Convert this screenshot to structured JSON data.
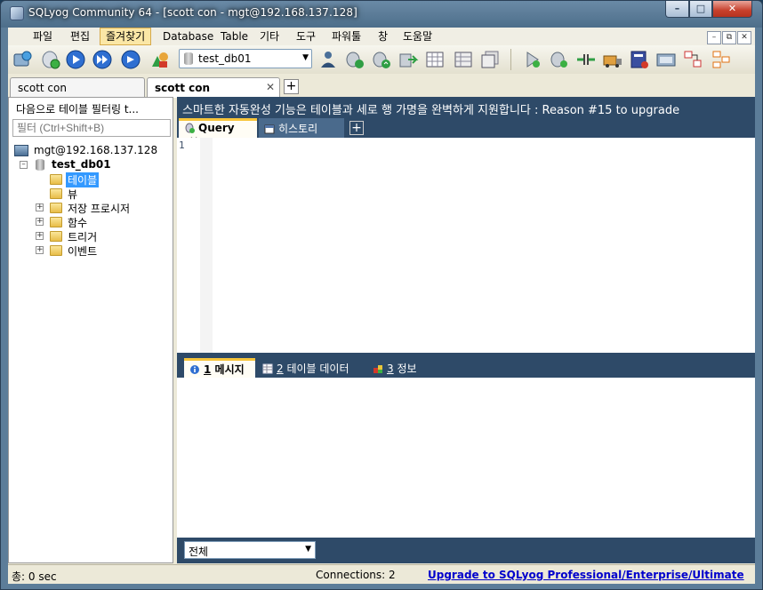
{
  "window": {
    "title": "SQLyog Community 64 - [scott con - mgt@192.168.137.128]",
    "controls": {
      "minimize": "–",
      "maximize": "□",
      "close": "✕"
    }
  },
  "menubar": {
    "items": [
      "파일",
      "편집",
      "즐겨찾기",
      "Database",
      "Table",
      "기타",
      "도구",
      "파워툴",
      "창",
      "도움말"
    ],
    "active_index": 2,
    "mdi_controls": [
      "–",
      "⧉",
      "✕"
    ]
  },
  "toolbar": {
    "database_selector": "test_db01"
  },
  "connection_tabs": [
    {
      "label": "scott con",
      "active": false
    },
    {
      "label": "scott con",
      "active": true,
      "close": "✕"
    }
  ],
  "connection_add": "+",
  "object_browser": {
    "filter_hint": "다음으로 테이블 필터링 t...",
    "filter_placeholder": "필터 (Ctrl+Shift+B)",
    "server": "mgt@192.168.137.128",
    "database": "test_db01",
    "nodes": [
      {
        "label": "테이블",
        "selected": true,
        "expandable": false
      },
      {
        "label": "뷰",
        "selected": false,
        "expandable": false
      },
      {
        "label": "저장 프로시저",
        "selected": false,
        "expandable": true
      },
      {
        "label": "함수",
        "selected": false,
        "expandable": true
      },
      {
        "label": "트리거",
        "selected": false,
        "expandable": true
      },
      {
        "label": "이벤트",
        "selected": false,
        "expandable": true
      }
    ],
    "expand_symbol": "+",
    "collapse_symbol": "–"
  },
  "editor_area": {
    "banner": "스마트한 자동완성 기능은 테이블과 세로 행 가명을 완벽하게 지원합니다 : Reason #15 to upgrade",
    "tabs": [
      {
        "label": "Query",
        "active": true,
        "close": "✕"
      },
      {
        "label": "히스토리",
        "active": false
      }
    ],
    "add_tab": "+",
    "line_number": "1"
  },
  "result_tabs": [
    {
      "num": "1",
      "label": " 메시지",
      "active": true
    },
    {
      "num": "2",
      "label": " 테이블 데이터",
      "active": false
    },
    {
      "num": "3",
      "label": " 정보",
      "active": false
    }
  ],
  "result_filter": "전체",
  "statusbar": {
    "exec_time": "총: 0 sec",
    "connections": "Connections: 2",
    "upgrade_link": "Upgrade to SQLyog Professional/Enterprise/Ultimate"
  },
  "colors": {
    "pane_background": "#2e4a68",
    "active_tab_accent": "#f7c53b",
    "selection": "#3399ff",
    "link": "#0000cc"
  }
}
